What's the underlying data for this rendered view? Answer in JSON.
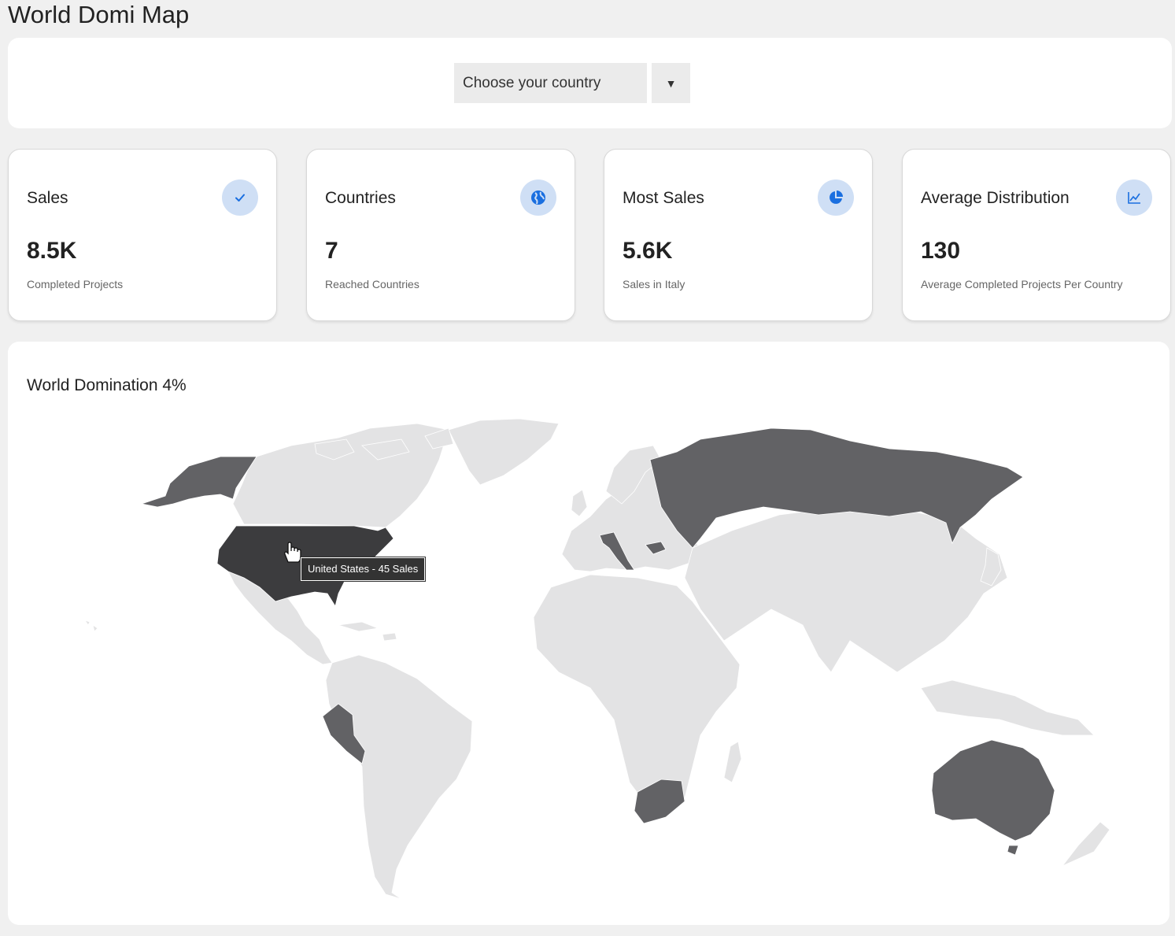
{
  "page": {
    "title": "World Domi Map"
  },
  "selector": {
    "placeholder": "Choose your country",
    "arrow": "▼"
  },
  "cards": [
    {
      "title": "Sales",
      "value": "8.5K",
      "subtitle": "Completed Projects",
      "icon": "check-icon"
    },
    {
      "title": "Countries",
      "value": "7",
      "subtitle": "Reached Countries",
      "icon": "globe-icon"
    },
    {
      "title": "Most Sales",
      "value": "5.6K",
      "subtitle": "Sales in Italy",
      "icon": "pie-chart-icon"
    },
    {
      "title": "Average Distribution",
      "value": "130",
      "subtitle": "Average Completed Projects Per Country",
      "icon": "line-chart-icon"
    }
  ],
  "map": {
    "title": "World Domination 4%",
    "tooltip": "United States - 45 Sales",
    "colors": {
      "land": "#e3e3e4",
      "highlight": "#626265",
      "hover": "#3c3c3e",
      "accent": "#1a6fe0",
      "icon_bg": "#cfdff5"
    },
    "highlighted_countries": [
      "United States",
      "Russia",
      "Italy",
      "Peru",
      "South Africa",
      "Australia",
      "Bulgaria"
    ],
    "hovered_country": "United States"
  }
}
